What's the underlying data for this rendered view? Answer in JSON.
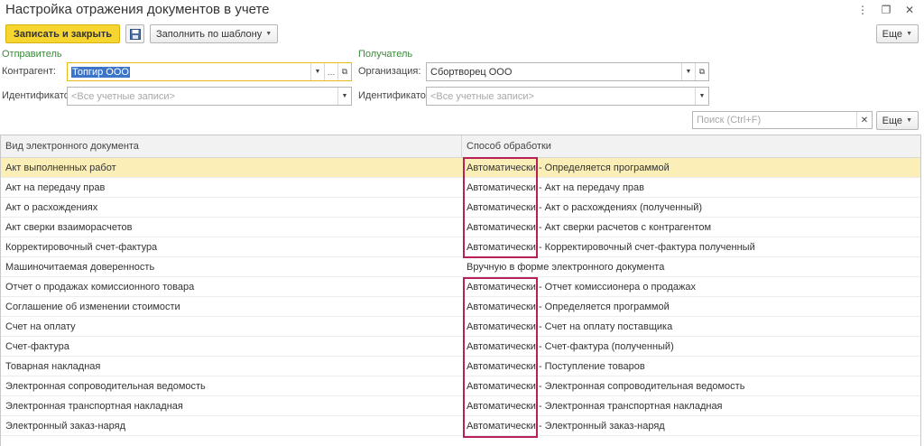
{
  "window": {
    "title": "Настройка отражения документов в учете"
  },
  "toolbar": {
    "save_close_label": "Записать и закрыть",
    "save_icon": "floppy-disk-icon",
    "fill_template_label": "Заполнить по шаблону",
    "more_label": "Еще"
  },
  "sender": {
    "section_title": "Отправитель",
    "contractor_label": "Контрагент:",
    "contractor_value": "Топгир ООО",
    "identifier_label": "Идентификатор:",
    "identifier_placeholder": "<Все учетные записи>"
  },
  "recipient": {
    "section_title": "Получатель",
    "organization_label": "Организация:",
    "organization_value": "Сбортворец ООО",
    "identifier_label": "Идентификатор:",
    "identifier_placeholder": "<Все учетные записи>"
  },
  "search": {
    "placeholder": "Поиск (Ctrl+F)",
    "more_label": "Еще"
  },
  "table": {
    "columns": [
      "Вид электронного документа",
      "Способ обработки"
    ],
    "rows": [
      {
        "doc": "Акт выполненных работ",
        "method": "Автоматически - Определяется программой"
      },
      {
        "doc": "Акт на передачу прав",
        "method": "Автоматически - Акт на передачу прав"
      },
      {
        "doc": "Акт о расхождениях",
        "method": "Автоматически - Акт о расхождениях (полученный)"
      },
      {
        "doc": "Акт сверки взаиморасчетов",
        "method": "Автоматически - Акт сверки расчетов с контрагентом"
      },
      {
        "doc": "Корректировочный счет-фактура",
        "method": "Автоматически - Корректировочный счет-фактура полученный"
      },
      {
        "doc": "Машиночитаемая доверенность",
        "method": "Вручную в форме электронного документа"
      },
      {
        "doc": "Отчет о продажах комиссионного товара",
        "method": "Автоматически - Отчет комиссионера о продажах"
      },
      {
        "doc": "Соглашение об изменении стоимости",
        "method": "Автоматически - Определяется программой"
      },
      {
        "doc": "Счет на оплату",
        "method": "Автоматически - Счет на оплату поставщика"
      },
      {
        "doc": "Счет-фактура",
        "method": "Автоматически - Счет-фактура (полученный)"
      },
      {
        "doc": "Товарная накладная",
        "method": "Автоматически - Поступление товаров"
      },
      {
        "doc": "Электронная сопроводительная ведомость",
        "method": "Автоматически - Электронная сопроводительная ведомость"
      },
      {
        "doc": "Электронная транспортная накладная",
        "method": "Автоматически - Электронная транспортная накладная"
      },
      {
        "doc": "Электронный заказ-наряд",
        "method": "Автоматически - Электронный заказ-наряд"
      }
    ]
  },
  "colors": {
    "primary_button": "#f7d530",
    "selected_row": "#fbeeb7",
    "section_title": "#3c8a3c",
    "highlight_box": "#b8205a"
  }
}
